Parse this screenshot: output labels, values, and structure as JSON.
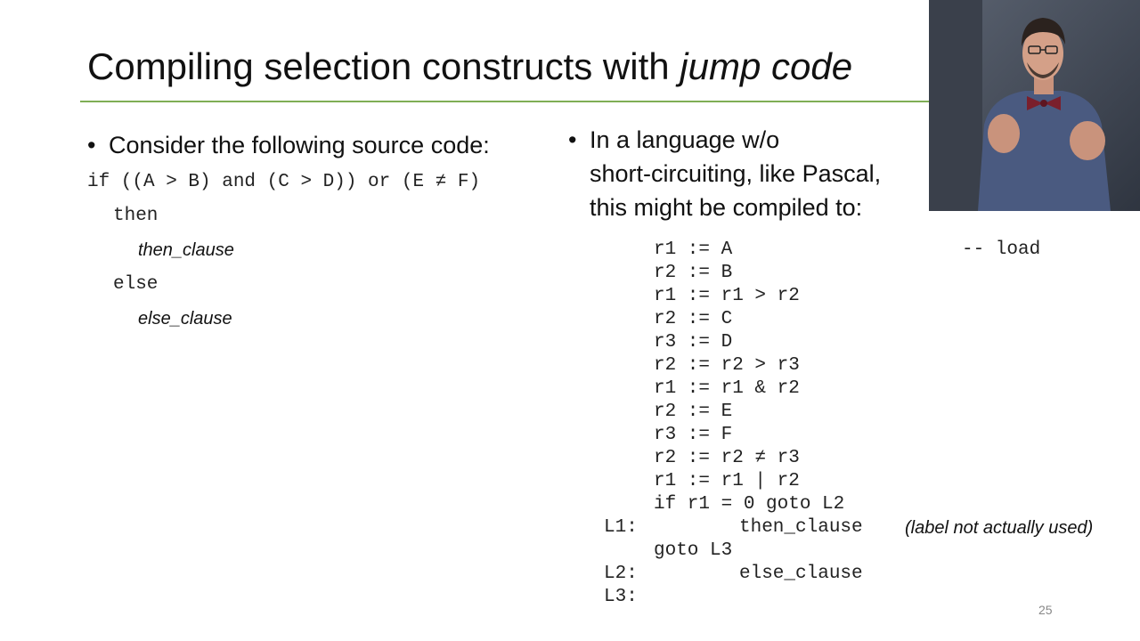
{
  "title": {
    "main": "Compiling selection constructs with ",
    "italic": "jump code"
  },
  "left": {
    "bullet": "Consider the following source code:",
    "code": {
      "line1": "if ((A > B) and (C > D)) or (E ≠ F)",
      "then": "then",
      "then_clause": "then_clause",
      "else": "else",
      "else_clause": "else_clause"
    }
  },
  "right": {
    "bullet_lines": [
      "In a language w/o",
      "short-circuiting, like Pascal,",
      "this might be compiled to:"
    ],
    "code_lines": [
      "r1 := A",
      "r2 := B",
      "r1 := r1 > r2",
      "r2 := C",
      "r3 := D",
      "r2 := r2 > r3",
      "r1 := r1 & r2",
      "r2 := E",
      "r3 := F",
      "r2 := r2 ≠ r3",
      "r1 := r1 | r2",
      "if r1 = 0 goto L2"
    ],
    "comment": "-- load",
    "labels": {
      "l1": "L1:",
      "l1_stmt": "then_clause",
      "l1_note": "(label not actually used)",
      "goto_l3": "goto L3",
      "l2": "L2:",
      "l2_stmt": "else_clause",
      "l3": "L3:"
    }
  },
  "page_number": "25",
  "colors": {
    "accent_rule": "#7fae55"
  }
}
